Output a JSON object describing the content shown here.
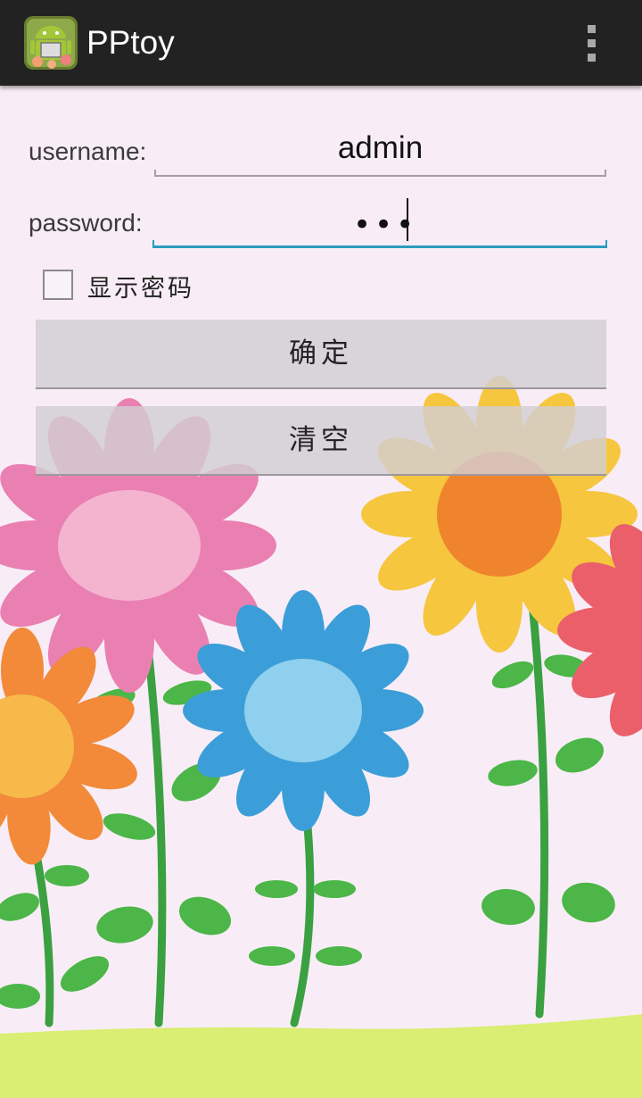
{
  "action_bar": {
    "title": "PPtoy",
    "app_icon": "android-app-icon",
    "overflow_icon": "overflow-menu-icon",
    "background_color": "#222222"
  },
  "form": {
    "username": {
      "label": "username:",
      "value": "admin"
    },
    "password": {
      "label": "password:",
      "masked_value": "•••"
    },
    "show_password": {
      "label": "显示密码",
      "checked": false
    },
    "confirm_button": {
      "label": "确定"
    },
    "clear_button": {
      "label": "清空"
    }
  },
  "background": {
    "description_icon": "flowers-illustration",
    "ground_color": "#d9ee72",
    "accent": "#2b9cc0"
  }
}
